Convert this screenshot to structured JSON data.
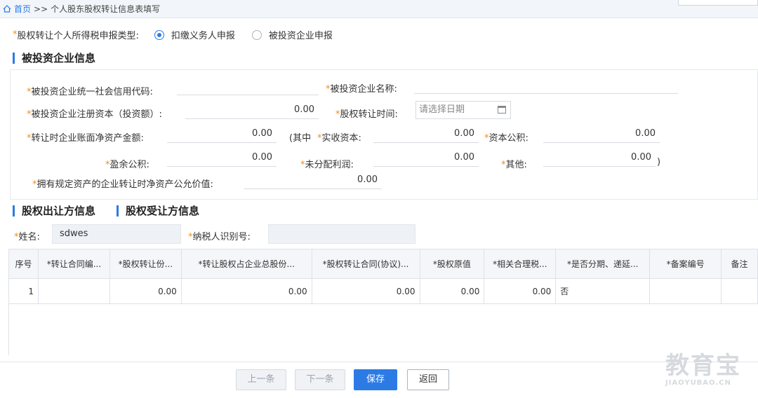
{
  "breadcrumb": {
    "home": "首页",
    "sep": ">>",
    "current": "个人股东股权转让信息表填写"
  },
  "declare_type": {
    "label": "股权转让个人所得税申报类型:",
    "options": [
      {
        "label": "扣缴义务人申报",
        "selected": true
      },
      {
        "label": "被投资企业申报",
        "selected": false
      }
    ]
  },
  "invested": {
    "title": "被投资企业信息",
    "credit_code_label": "被投资企业统一社会信用代码:",
    "credit_code_value": "",
    "name_label": "被投资企业名称:",
    "name_value": "",
    "reg_capital_label": "被投资企业注册资本（投资额）:",
    "reg_capital_value": "0.00",
    "transfer_date_label": "股权转让时间:",
    "transfer_date_placeholder": "请选择日期",
    "net_assets_label": "转让时企业账面净资产金额:",
    "net_assets_value": "0.00",
    "paren_open": "(其中",
    "paid_capital_label": "实收资本:",
    "paid_capital_value": "0.00",
    "capital_reserve_label": "资本公积:",
    "capital_reserve_value": "0.00",
    "surplus_label": "盈余公积:",
    "surplus_value": "0.00",
    "undistributed_label": "未分配利润:",
    "undistributed_value": "0.00",
    "other_label": "其他:",
    "other_value": "0.00",
    "paren_close": ")",
    "fair_value_label": "拥有规定资产的企业转让时净资产公允价值:",
    "fair_value_value": "0.00"
  },
  "tabs": {
    "transferor": "股权出让方信息",
    "transferee": "股权受让方信息"
  },
  "person": {
    "name_label": "姓名:",
    "name_value": "sdwes",
    "taxid_label": "纳税人识别号:",
    "taxid_value": ""
  },
  "table": {
    "headers": [
      "序号",
      "*转让合同编...",
      "*股权转让份...",
      "*转让股权占企业总股份...",
      "*股权转让合同(协议)...",
      "*股权原值",
      "*相关合理税...",
      "*是否分期、递延...",
      "*备案编号",
      "备注"
    ],
    "rows": [
      [
        "1",
        "",
        "0.00",
        "0.00",
        "0.00",
        "0.00",
        "0.00",
        "否",
        "",
        ""
      ]
    ]
  },
  "buttons": {
    "prev": "上一条",
    "next": "下一条",
    "save": "保存",
    "back": "返回"
  },
  "watermark": {
    "cn": "教育宝",
    "en": "JIAOYUBAO.CN"
  },
  "colors": {
    "accent": "#2c7be5",
    "required": "#f08c1c"
  }
}
